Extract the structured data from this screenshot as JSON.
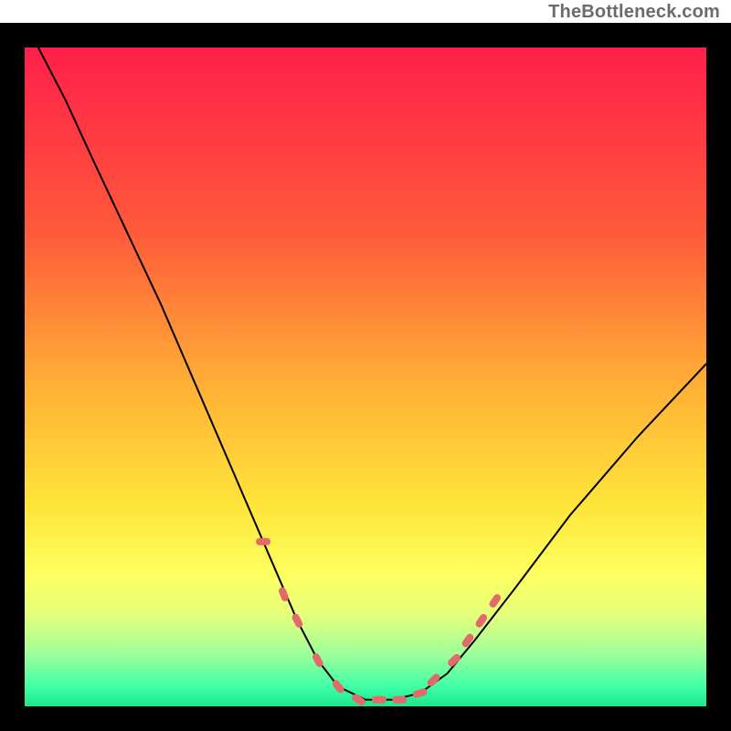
{
  "watermark": "TheBottleneck.com",
  "colors": {
    "frame": "#000000",
    "curve": "#000000",
    "markers": "#e46a6a",
    "gradient_stops": [
      {
        "offset": 0.0,
        "color": "#ff1f4b"
      },
      {
        "offset": 0.28,
        "color": "#ff5a3a"
      },
      {
        "offset": 0.52,
        "color": "#ffb236"
      },
      {
        "offset": 0.7,
        "color": "#ffe63a"
      },
      {
        "offset": 0.8,
        "color": "#fdff60"
      },
      {
        "offset": 0.86,
        "color": "#e6ff7a"
      },
      {
        "offset": 0.92,
        "color": "#9fff9a"
      },
      {
        "offset": 0.97,
        "color": "#3fffa6"
      },
      {
        "offset": 1.0,
        "color": "#19e88f"
      }
    ]
  },
  "chart_data": {
    "type": "line",
    "title": "",
    "xlabel": "",
    "ylabel": "",
    "xlim": [
      0,
      1
    ],
    "ylim": [
      0,
      1
    ],
    "x": [
      0.02,
      0.06,
      0.1,
      0.15,
      0.2,
      0.25,
      0.3,
      0.35,
      0.4,
      0.43,
      0.46,
      0.5,
      0.54,
      0.58,
      0.62,
      0.66,
      0.72,
      0.8,
      0.9,
      1.0
    ],
    "series": [
      {
        "name": "bottleneck-curve",
        "values": [
          1.0,
          0.92,
          0.83,
          0.72,
          0.61,
          0.49,
          0.37,
          0.25,
          0.13,
          0.07,
          0.03,
          0.01,
          0.01,
          0.02,
          0.05,
          0.1,
          0.18,
          0.29,
          0.41,
          0.52
        ]
      }
    ],
    "markers": {
      "name": "highlighted-points",
      "x": [
        0.35,
        0.38,
        0.4,
        0.43,
        0.46,
        0.49,
        0.52,
        0.55,
        0.58,
        0.6,
        0.63,
        0.65,
        0.67,
        0.69
      ],
      "values": [
        0.25,
        0.17,
        0.13,
        0.07,
        0.03,
        0.01,
        0.01,
        0.01,
        0.02,
        0.04,
        0.07,
        0.1,
        0.13,
        0.16
      ]
    }
  }
}
